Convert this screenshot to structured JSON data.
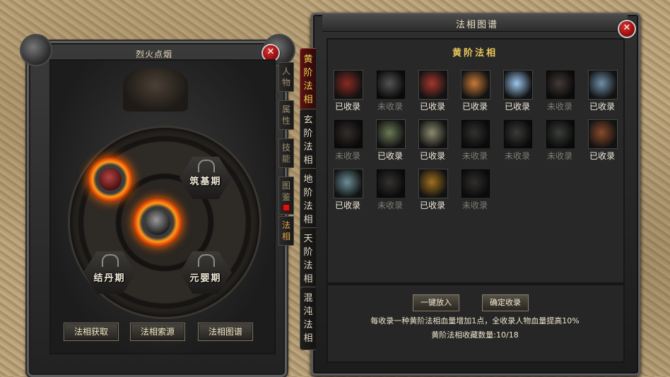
{
  "left_panel": {
    "title": "烈火点烟",
    "close": "✕",
    "stages": [
      "筑基期",
      "结丹期",
      "元婴期"
    ],
    "buttons": [
      "法相获取",
      "法相索源",
      "法相图谱"
    ],
    "side_tabs": [
      {
        "label": "人物",
        "active": false
      },
      {
        "label": "属性",
        "active": false
      },
      {
        "label": "技能",
        "active": false
      },
      {
        "label": "图鉴",
        "active": false,
        "badge": true
      },
      {
        "label": "法相",
        "active": true
      }
    ]
  },
  "right_panel": {
    "title": "法相图谱",
    "close": "✕",
    "section_title": "黄阶法相",
    "tabs": [
      {
        "label": "黄阶法相",
        "active": true
      },
      {
        "label": "玄阶法相",
        "active": false
      },
      {
        "label": "地阶法相",
        "active": false
      },
      {
        "label": "天阶法相",
        "active": false
      },
      {
        "label": "混沌法相",
        "active": false
      }
    ],
    "collected_label": "已收录",
    "uncollected_label": "未收录",
    "items": [
      {
        "status": "已收录",
        "color": "#8a2a22",
        "icon": "red-beast"
      },
      {
        "status": "未收录",
        "color": "#8f9a9a",
        "icon": "ghost-beast"
      },
      {
        "status": "已收录",
        "color": "#a3372e",
        "icon": "demon-beast"
      },
      {
        "status": "已收录",
        "color": "#c77a3a",
        "icon": "deer-beast"
      },
      {
        "status": "已收录",
        "color": "#9cc6ee",
        "icon": "spirit-beast"
      },
      {
        "status": "未收录",
        "color": "#c1582a",
        "icon": "fox-beast"
      },
      {
        "status": "已收录",
        "color": "#6f8fa8",
        "icon": "armored-beast"
      },
      {
        "status": "未收录",
        "color": "#8b4a2a",
        "icon": "bird-beast"
      },
      {
        "status": "已收录",
        "color": "#6a7a55",
        "icon": "skull-beast"
      },
      {
        "status": "已收录",
        "color": "#8a8a70",
        "icon": "boar-beast"
      },
      {
        "status": "未收录",
        "color": "#5a5a50",
        "icon": "shadow-beast"
      },
      {
        "status": "未收录",
        "color": "#6e6a5e",
        "icon": "bat-beast"
      },
      {
        "status": "未收录",
        "color": "#4e7a4a",
        "icon": "dragon-beast"
      },
      {
        "status": "已收录",
        "color": "#8a4a2a",
        "icon": "rock-beast"
      },
      {
        "status": "已收录",
        "color": "#6a8f98",
        "icon": "serpent-beast"
      },
      {
        "status": "未收录",
        "color": "#6a5a3a",
        "icon": "worm-beast"
      },
      {
        "status": "已收录",
        "color": "#a0701e",
        "icon": "centipede-beast"
      },
      {
        "status": "未收录",
        "color": "#7a4a44",
        "icon": "winged-beast"
      }
    ],
    "buttons": {
      "put_all": "一键放入",
      "confirm": "确定收录"
    },
    "note": "每收录一种黄阶法相血量增加1点，全收录人物血量提高10%",
    "count": "黄阶法相收藏数量:10/18"
  }
}
